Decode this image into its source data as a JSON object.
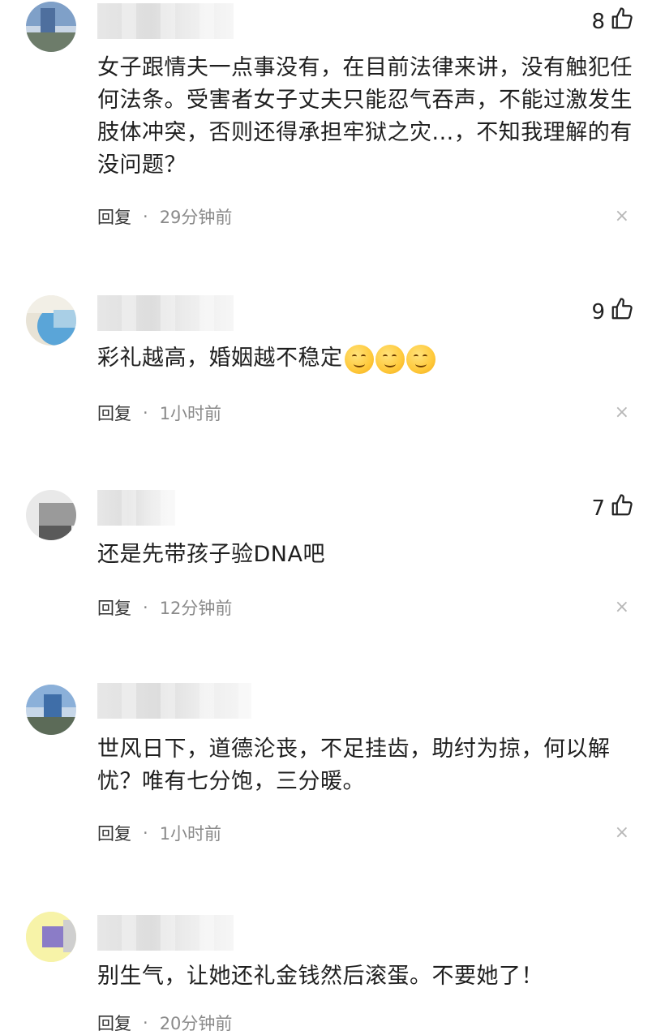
{
  "comments": [
    {
      "likes": "8",
      "text": "女子跟情夫一点事没有，在目前法律来讲，没有触犯任何法条。受害者女子丈夫只能忍气吞声，不能过激发生肢体冲突，否则还得承担牢狱之灾...，不知我理解的有没问题？",
      "reply": "回复",
      "dot": "·",
      "time": "29分钟前",
      "close": "×"
    },
    {
      "likes": "9",
      "text": "彩礼越高，婚姻越不稳定",
      "emoji_count": 3,
      "reply": "回复",
      "dot": "·",
      "time": "1小时前",
      "close": "×"
    },
    {
      "likes": "7",
      "text": "还是先带孩子验DNA吧",
      "reply": "回复",
      "dot": "·",
      "time": "12分钟前",
      "close": "×"
    },
    {
      "likes": "",
      "text": "世风日下，道德沦丧，不足挂齿，助纣为掠，何以解忧？唯有七分饱，三分暖。",
      "reply": "回复",
      "dot": "·",
      "time": "1小时前",
      "close": "×"
    },
    {
      "likes": "",
      "text": "别生气，让她还礼金钱然后滚蛋。不要她了！",
      "reply": "回复",
      "dot": "·",
      "time": "20分钟前",
      "close": ""
    }
  ],
  "icons": {
    "like": "thumbs-up-icon",
    "close": "close-icon",
    "emoji": "smile-emoji-icon"
  }
}
